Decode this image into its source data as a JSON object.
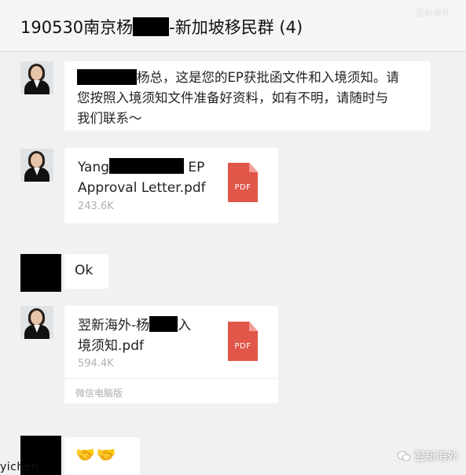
{
  "header": {
    "title_prefix": "190530南京杨",
    "title_suffix": "-新加坡移民群 (4)",
    "watermark": "翌新海外"
  },
  "messages": [
    {
      "sender": "agent",
      "type": "text",
      "text_line1": "杨总，这是您的EP获批函文件和入境须知。请",
      "text_line2": "您按照入境须知文件准备好资料，如有不明，请随时与",
      "text_line3": "我们联系～"
    },
    {
      "sender": "agent",
      "type": "file",
      "name_part1": "Yang",
      "name_part2": " EP",
      "name_part3": "Approval Letter.pdf",
      "size": "243.6K",
      "icon": "PDF"
    },
    {
      "sender": "client",
      "type": "text",
      "text": "Ok"
    },
    {
      "sender": "agent",
      "type": "file",
      "name_part1": "翌新海外-杨",
      "name_part2": "入",
      "name_part3": "境须知.pdf",
      "size": "594.4K",
      "icon": "PDF",
      "client": "微信电脑版"
    },
    {
      "sender": "client",
      "type": "emoji",
      "emoji": "🤝🤝"
    }
  ],
  "footer": {
    "left_text": "yichen",
    "right_text": "翌新海外",
    "icon": "wechat-official-account-icon"
  },
  "colors": {
    "background": "#f1f1f1",
    "bubble": "#ffffff",
    "pdf": "#e05649",
    "meta_text": "#b1b1b1"
  }
}
